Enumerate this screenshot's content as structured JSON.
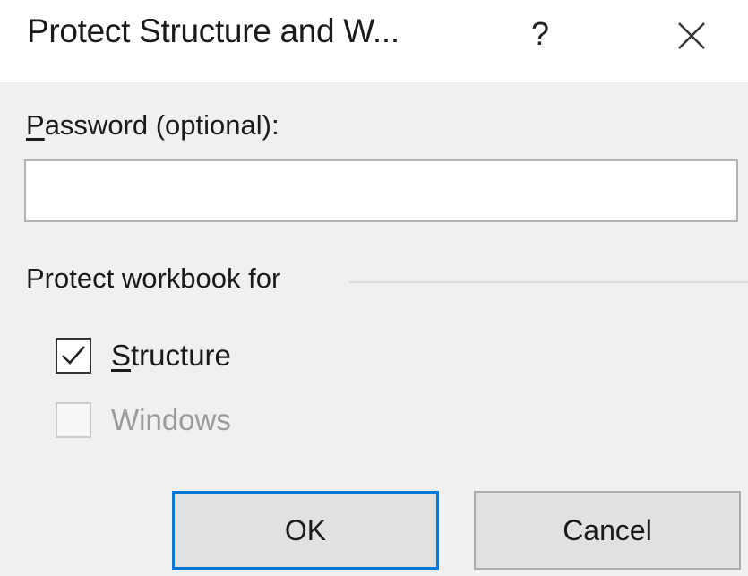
{
  "dialog": {
    "title": "Protect Structure and W...",
    "help_label": "?",
    "close_icon": "close-icon"
  },
  "password": {
    "label_accel": "P",
    "label_rest": "assword (optional):",
    "value": "",
    "placeholder": ""
  },
  "group": {
    "label": "Protect workbook for",
    "options": [
      {
        "accel": "S",
        "rest": "tructure",
        "checked": true,
        "enabled": true
      },
      {
        "accel": "",
        "rest": "Windows",
        "checked": false,
        "enabled": false
      }
    ]
  },
  "buttons": {
    "ok_label": "OK",
    "cancel_label": "Cancel"
  },
  "colors": {
    "accent": "#0078d7",
    "dialog_bg": "#f0f0f0",
    "titlebar_bg": "#ffffff"
  }
}
